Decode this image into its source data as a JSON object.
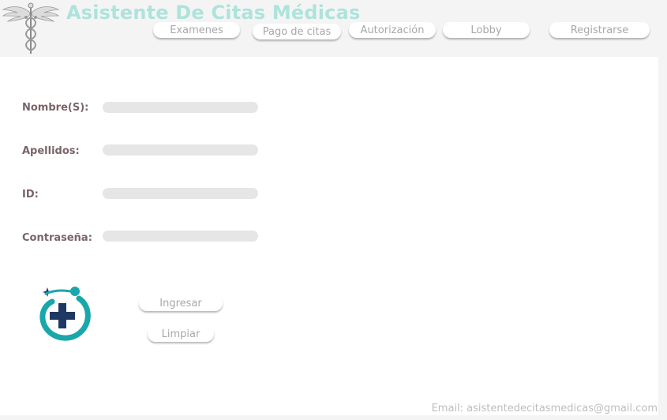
{
  "header": {
    "title": "Asistente De Citas Médicas",
    "logo_icon": "caduceus-icon",
    "nav": [
      {
        "label": "Examenes"
      },
      {
        "label": "Pago de citas"
      },
      {
        "label": "Autorización"
      },
      {
        "label": "Lobby"
      },
      {
        "label": "Registrarse"
      }
    ]
  },
  "form": {
    "fields": [
      {
        "label": "Nombre(S):",
        "value": ""
      },
      {
        "label": "Apellidos:",
        "value": ""
      },
      {
        "label": "ID:",
        "value": ""
      },
      {
        "label": "Contraseña:",
        "value": ""
      }
    ],
    "logo_icon": "medical-cross-icon",
    "submit_label": "Ingresar",
    "clear_label": "Limpiar"
  },
  "footer": {
    "email": "Email: asistentedecitasmedicas@gmail.com"
  },
  "colors": {
    "title": "#aee3dc",
    "label": "#7a6468",
    "teal": "#19a7aa",
    "navy": "#1e3864",
    "button_text": "#a8a8a8"
  }
}
